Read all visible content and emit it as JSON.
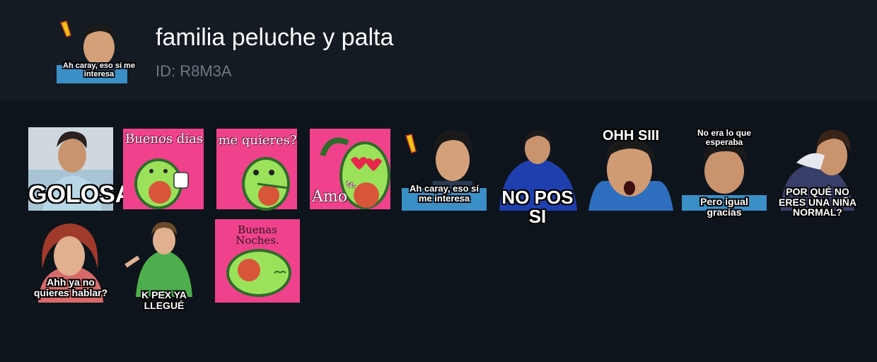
{
  "pack": {
    "title": "familia peluche y palta",
    "id_text": "ID: R8M3A",
    "thumb_caption": "Ah caray, eso sí me interesa"
  },
  "stickers": [
    {
      "caption": "GOLOSA"
    },
    {
      "caption": "Buenos dias"
    },
    {
      "caption": "me quieres?"
    },
    {
      "caption_small": "te",
      "caption": "Amo"
    },
    {
      "caption": "Ah caray, eso sí me interesa"
    },
    {
      "caption": "NO POS SI"
    },
    {
      "caption": "OHH SIII"
    },
    {
      "caption_top": "No era lo que esperaba",
      "caption": "Pero igual gracias"
    },
    {
      "caption": "POR QUÉ NO ERES UNA NIÑA NORMAL?"
    },
    {
      "caption": "Ahh ya no quieres hablar?"
    },
    {
      "caption": "K PEX YA LLEGUÉ"
    },
    {
      "caption": "Buenas Noches."
    }
  ],
  "colors": {
    "background": "#0e141b",
    "header": "#141b23",
    "sticker_pink": "#f0428c",
    "avocado_green": "#9be15a",
    "avocado_pit": "#d9553a"
  }
}
